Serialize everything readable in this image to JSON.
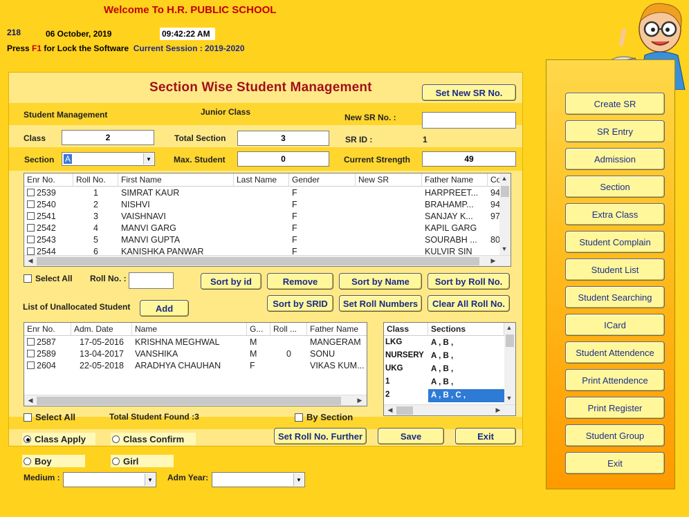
{
  "header": {
    "welcome": "Welcome To  H.R. PUBLIC SCHOOL",
    "code": "218",
    "date": "06 October, 2019",
    "time": "09:42:22 AM",
    "press": "Press",
    "f1": "F1",
    "lock_text": "for Lock the Software",
    "session": "Current Session : 2019-2020"
  },
  "main": {
    "title": "Section Wise Student Management",
    "set_new_sr_label": "Set New SR No.",
    "student_management_label": "Student Management",
    "junior_class_label": "Junior Class",
    "new_sr_label": "New SR No. :",
    "new_sr_value": "",
    "class_label": "Class",
    "class_value": "2",
    "total_section_label": "Total Section",
    "total_section_value": "3",
    "srid_label": "SR ID :",
    "srid_value": "1",
    "section_label": "Section",
    "section_value": "A",
    "max_student_label": "Max. Student",
    "max_student_value": "0",
    "current_strength_label": "Current Strength",
    "current_strength_value": "49"
  },
  "students_grid": {
    "columns": [
      "Enr No.",
      "Roll No.",
      "First Name",
      "Last Name",
      "Gender",
      "New SR",
      "Father Name",
      "Co"
    ],
    "rows": [
      {
        "enr": "2539",
        "roll": "1",
        "first": "SIMRAT KAUR",
        "last": "",
        "gender": "F",
        "new_sr": "",
        "father": "HARPREET...",
        "co": "94"
      },
      {
        "enr": "2540",
        "roll": "2",
        "first": "NISHVI",
        "last": "",
        "gender": "F",
        "new_sr": "",
        "father": "BRAHAMP...",
        "co": "94"
      },
      {
        "enr": "2541",
        "roll": "3",
        "first": "VAISHNAVI",
        "last": "",
        "gender": "F",
        "new_sr": "",
        "father": "SANJAY K...",
        "co": "97"
      },
      {
        "enr": "2542",
        "roll": "4",
        "first": "MANVI GARG",
        "last": "",
        "gender": "F",
        "new_sr": "",
        "father": "KAPIL GARG",
        "co": ""
      },
      {
        "enr": "2543",
        "roll": "5",
        "first": "MANVI GUPTA",
        "last": "",
        "gender": "F",
        "new_sr": "",
        "father": "SOURABH ...",
        "co": "80"
      },
      {
        "enr": "2544",
        "roll": "6",
        "first": "KANISHKA PANWAR",
        "last": "",
        "gender": "F",
        "new_sr": "",
        "father": "KULVIR SIN",
        "co": ""
      }
    ]
  },
  "actions": {
    "select_all_label": "Select All",
    "roll_no_label": "Roll No. :",
    "roll_no_value": "",
    "sort_by_id": "Sort by id",
    "remove": "Remove",
    "sort_by_name": "Sort by Name",
    "sort_by_roll": "Sort by Roll No.",
    "unallocated_label": "List of Unallocated Student",
    "add": "Add",
    "sort_by_srid": "Sort by SRID",
    "set_roll_numbers": "Set Roll Numbers",
    "clear_all_roll": "Clear All Roll No."
  },
  "unallocated_grid": {
    "columns": [
      "Enr No.",
      "Adm. Date",
      "Name",
      "G...",
      "Roll ...",
      "Father Name"
    ],
    "rows": [
      {
        "enr": "2587",
        "date": "17-05-2016",
        "name": "KRISHNA MEGHWAL",
        "g": "M",
        "roll": "",
        "father": "MANGERAM"
      },
      {
        "enr": "2589",
        "date": "13-04-2017",
        "name": "VANSHIKA",
        "g": "M",
        "roll": "0",
        "father": "SONU"
      },
      {
        "enr": "2604",
        "date": "22-05-2018",
        "name": "ARADHYA CHAUHAN",
        "g": "F",
        "roll": "",
        "father": "VIKAS KUM..."
      }
    ]
  },
  "class_sections": {
    "columns": [
      "Class",
      "Sections"
    ],
    "rows": [
      {
        "class": "LKG",
        "sections": "A , B ,"
      },
      {
        "class": "NURSERY",
        "sections": "A , B ,"
      },
      {
        "class": "UKG",
        "sections": "A , B ,"
      },
      {
        "class": "1",
        "sections": "A , B ,"
      },
      {
        "class": "2",
        "sections": "A , B , C ,"
      }
    ]
  },
  "bottom": {
    "select_all_label": "Select All",
    "total_found": "Total Student Found :3",
    "by_section_label": "By Section",
    "class_apply": "Class Apply",
    "class_confirm": "Class Confirm",
    "set_roll_further": "Set Roll No. Further",
    "save": "Save",
    "exit": "Exit",
    "boy": "Boy",
    "girl": "Girl",
    "medium_label": "Medium :",
    "adm_year_label": "Adm Year:"
  },
  "nav": {
    "items": [
      "Create SR",
      "SR Entry",
      "Admission",
      "Section",
      "Extra Class",
      "Student Complain",
      "Student List",
      "Student Searching",
      "ICard",
      "Student Attendence",
      "Print Attendence",
      "Print Register",
      "Student Group",
      "Exit"
    ]
  },
  "colors": {
    "background": "#ffd21e",
    "panel": "#ffe987",
    "button": "#fff79a",
    "title": "#a0101a",
    "selection": "#2e7bd6"
  }
}
